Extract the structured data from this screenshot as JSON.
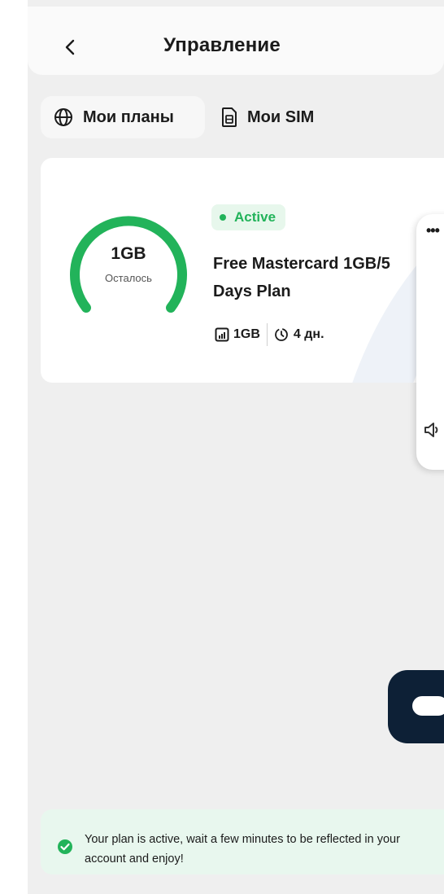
{
  "header": {
    "title": "Управление",
    "back_icon": "chevron-left-icon"
  },
  "tabs": [
    {
      "label": "Мои планы",
      "icon": "globe-icon",
      "active": true
    },
    {
      "label": "Мои SIM",
      "icon": "sim-card-icon",
      "active": false
    }
  ],
  "plan": {
    "remaining_value": "1GB",
    "remaining_label": "Осталось",
    "remaining_fraction": 1.0,
    "status": "Active",
    "name_line1": "Free Mastercard 1GB/5",
    "name_line2": "Days Plan",
    "data_amount": "1GB",
    "duration": "4 дн."
  },
  "side_panel": {
    "menu_icon": "more-dots-icon",
    "speaker_icon": "speaker-icon",
    "menu_text": "•••"
  },
  "chat": {
    "icon": "chat-bubble-icon"
  },
  "toast": {
    "message": "Your plan is active, wait a few minutes to be reflected in your account and enjoy!",
    "icon": "check-circle-icon"
  },
  "colors": {
    "accent_green": "#22b35a",
    "badge_bg": "#e7f7ec",
    "chat_fab_bg": "#0d2036",
    "screen_bg": "#efefef"
  }
}
